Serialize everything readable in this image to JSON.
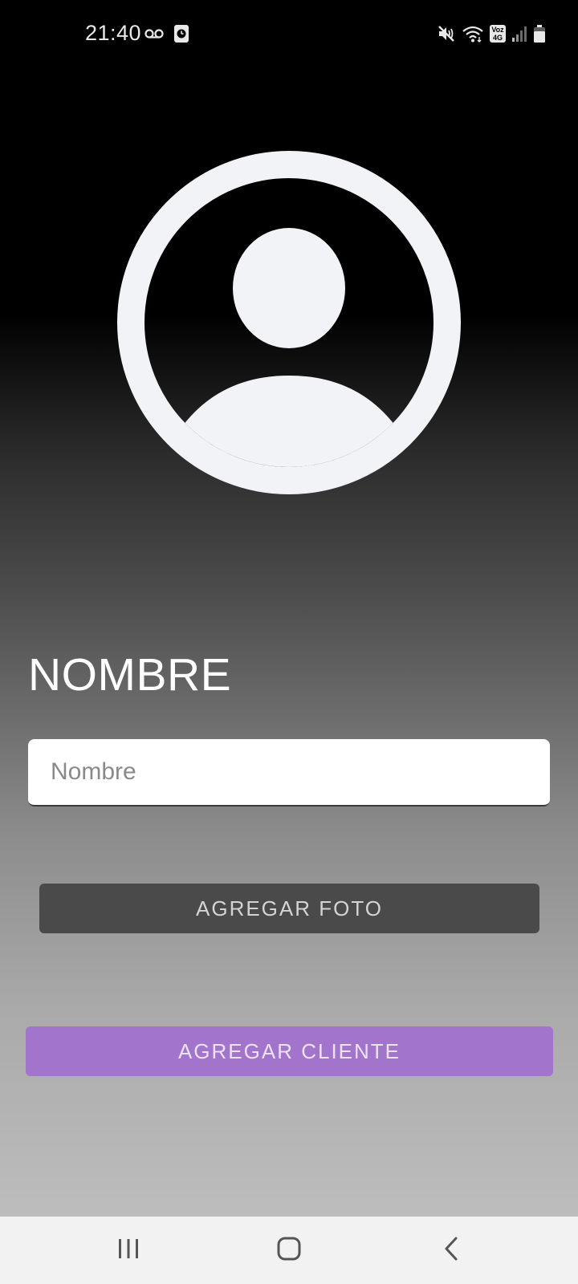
{
  "status_bar": {
    "time": "21:40",
    "left_icons": [
      "voicemail-icon",
      "clock-app-icon"
    ],
    "right_icons": [
      "mute-icon",
      "wifi-icon",
      "volte-4g-icon",
      "signal-icon",
      "battery-icon"
    ],
    "network_badge_top": "Voz",
    "network_badge_bottom": "4G"
  },
  "avatar": {
    "icon": "account-circle-icon",
    "color": "#f2f3f7"
  },
  "form": {
    "name_label": "NOMBRE",
    "name_input_placeholder": "Nombre",
    "name_input_value": ""
  },
  "buttons": {
    "add_photo": "AGREGAR FOTO",
    "add_client": "AGREGAR CLIENTE"
  },
  "colors": {
    "add_photo_bg": "#4a4a4a",
    "add_client_bg": "#a274cb",
    "nav_bar_bg": "#f2f2f2"
  },
  "nav_bar": {
    "items": [
      "recents-icon",
      "home-icon",
      "back-icon"
    ]
  }
}
